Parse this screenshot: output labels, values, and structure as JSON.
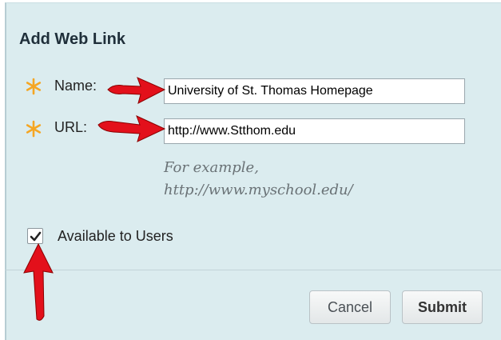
{
  "dialog": {
    "title": "Add Web Link",
    "fields": {
      "name": {
        "label": "Name:",
        "value": "University of St. Thomas Homepage",
        "required": true
      },
      "url": {
        "label": "URL:",
        "value": "http://www.Stthom.edu",
        "required": true
      },
      "hint_line1": "For example,",
      "hint_line2": "http://www.myschool.edu/"
    },
    "availability": {
      "label": "Available to Users",
      "checked": true
    },
    "buttons": {
      "cancel": "Cancel",
      "submit": "Submit"
    }
  },
  "colors": {
    "dialog_bg": "#dbecef",
    "required_star": "#f5a623",
    "annotation_arrow": "#e3101b"
  },
  "icons": [
    "required-asterisk-icon",
    "checkmark-icon",
    "annotation-arrow-icon"
  ]
}
